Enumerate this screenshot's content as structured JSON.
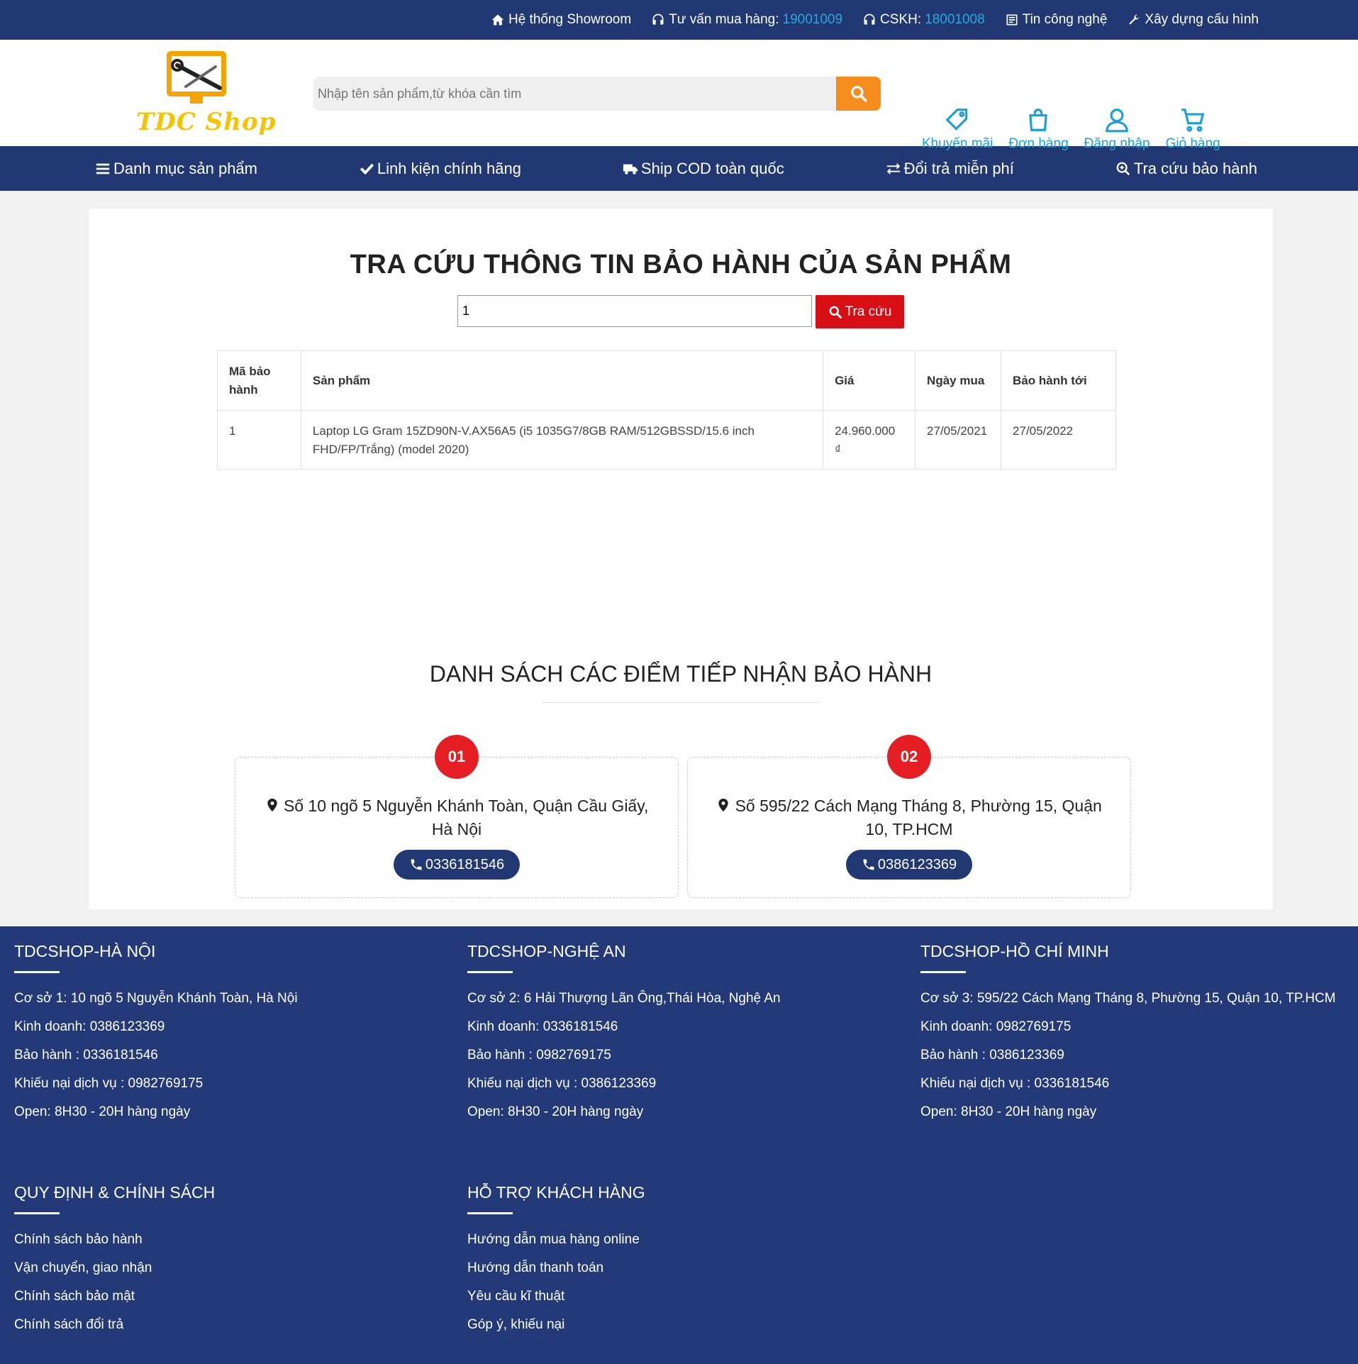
{
  "topbar": {
    "showroom": "Hệ thống Showroom",
    "consult_label": "Tư vấn mua hàng: ",
    "consult_phone": "19001009",
    "cskh_label": "CSKH: ",
    "cskh_phone": "18001008",
    "news": "Tin công nghệ",
    "build": "Xây dựng cấu hình"
  },
  "header": {
    "logo_text": "TDC Shop",
    "search_placeholder": "Nhập tên sản phẩm,từ khóa cần tìm",
    "icons": {
      "promo": "Khuyến mãi",
      "orders": "Đơn hàng",
      "login": "Đăng nhập",
      "cart": "Giỏ hàng"
    }
  },
  "navbar": {
    "categories": "Danh mục sản phẩm",
    "genuine": "Linh kiện chính hãng",
    "ship": "Ship COD toàn quốc",
    "return": "Đổi trả miễn phí",
    "warranty": "Tra cứu bảo hành"
  },
  "lookup": {
    "title": "TRA CỨU THÔNG TIN BẢO HÀNH CỦA SẢN PHẨM",
    "input_value": "1",
    "button": "Tra cứu"
  },
  "table": {
    "headers": [
      "Mã bảo hành",
      "Sản phẩm",
      "Giá",
      "Ngày mua",
      "Bảo hành tới"
    ],
    "rows": [
      [
        "1",
        "Laptop LG Gram 15ZD90N-V.AX56A5 (i5 1035G7/8GB RAM/512GBSSD/15.6 inch FHD/FP/Trắng) (model 2020)",
        "24.960.000 ₫",
        "27/05/2021",
        "27/05/2022"
      ]
    ]
  },
  "points": {
    "title": "DANH SÁCH CÁC ĐIỂM TIẾP NHẬN BẢO HÀNH",
    "items": [
      {
        "num": "01",
        "address": "Số 10 ngõ 5 Nguyễn Khánh Toàn, Quận Cầu Giấy, Hà Nội",
        "phone": "0336181546"
      },
      {
        "num": "02",
        "address": "Số 595/22 Cách Mạng Tháng 8, Phường 15, Quận 10, TP.HCM",
        "phone": "0386123369"
      }
    ]
  },
  "footer": {
    "branches": [
      {
        "title": "TDCSHOP-HÀ NỘI",
        "lines": [
          "Cơ sở 1: 10 ngõ 5 Nguyễn Khánh Toàn, Hà Nội",
          "Kinh doanh: 0386123369",
          "Bảo hành : 0336181546",
          "Khiếu nại dịch vụ : 0982769175",
          "Open: 8H30 - 20H hàng ngày"
        ]
      },
      {
        "title": "TDCSHOP-NGHỆ AN",
        "lines": [
          "Cơ sở 2: 6 Hải Thượng Lãn Ông,Thái Hòa, Nghệ An",
          "Kinh doanh: 0336181546",
          "Bảo hành : 0982769175",
          "Khiếu nại dịch vụ : 0386123369",
          "Open: 8H30 - 20H hàng ngày"
        ]
      },
      {
        "title": "TDCSHOP-HỒ CHÍ MINH",
        "lines": [
          "Cơ sở 3: 595/22 Cách Mạng Tháng 8, Phường 15, Quận 10, TP.HCM",
          "Kinh doanh: 0982769175",
          "Bảo hành : 0386123369",
          "Khiếu nại dịch vụ : 0336181546",
          "Open: 8H30 - 20H hàng ngày"
        ]
      }
    ],
    "policy": {
      "title": "QUY ĐỊNH & CHÍNH SÁCH",
      "links": [
        "Chính sách bảo hành",
        "Vận chuyển, giao nhận",
        "Chính sách bảo mật",
        "Chính sách đổi trả"
      ]
    },
    "support": {
      "title": "HỖ TRỢ KHÁCH HÀNG",
      "links": [
        "Hướng dẫn mua hàng online",
        "Hướng dẫn thanh toán",
        "Yêu cầu kĩ thuật",
        "Góp ý, khiếu nại"
      ]
    }
  },
  "colors": {
    "navy": "#213872",
    "accent_blue": "#1aa0d8",
    "orange": "#f78c1e",
    "red": "#d70f15"
  }
}
